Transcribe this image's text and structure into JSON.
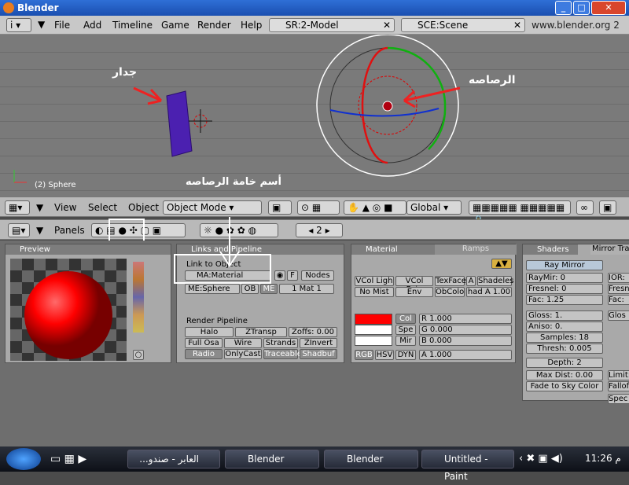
{
  "window": {
    "title": "Blender"
  },
  "menubar": {
    "items": [
      "File",
      "Add",
      "Timeline",
      "Game",
      "Render",
      "Help"
    ],
    "screen": "SR:2-Model",
    "scene": "SCE:Scene",
    "url": "www.blender.org 2"
  },
  "viewport": {
    "object_label": "(2) Sphere",
    "annotations": {
      "wall": "جدار",
      "bullet": "الرصاصه",
      "material_name": "أسم خامة الرصاصه"
    },
    "colors": {
      "wall": "#4b20b0",
      "ring_red": "#e01010",
      "ring_green": "#10b010",
      "ring_blue": "#1030d0"
    }
  },
  "view_header": {
    "view": "View",
    "select": "Select",
    "object": "Object",
    "mode": "Object Mode",
    "orientation": "Global"
  },
  "buttons_header": {
    "panels": "Panels",
    "frame": "2"
  },
  "preview": {
    "title": "Preview"
  },
  "links": {
    "title": "Links and Pipeline",
    "link_to_object": "Link to Object",
    "material": "MA:Material",
    "f": "F",
    "nodes": "Nodes",
    "mesh": "ME:Sphere",
    "ob": "OB",
    "me": "ME",
    "mat": "1 Mat 1",
    "render_pipeline": "Render Pipeline",
    "halo": "Halo",
    "ztransp": "ZTransp",
    "zoffs": "Zoffs: 0.00",
    "fullosa": "Full Osa",
    "wire": "Wire",
    "strands": "Strands",
    "zinvert": "ZInvert",
    "radio": "Radio",
    "onlycast": "OnlyCast",
    "traceable": "Traceable",
    "shadbuf": "Shadbuf"
  },
  "material": {
    "tab": "Material",
    "ramps": "Ramps",
    "vcol_light": "VCol Ligh",
    "vcol_paint": "VCol Pain",
    "texface": "TexFace",
    "a": "A",
    "shadeles": "Shadeles",
    "no_mist": "No Mist",
    "env": "Env",
    "obcolor": "ObColo",
    "hada": "had A 1.00",
    "col": "Col",
    "spe": "Spe",
    "mir": "Mir",
    "r": "R 1.000",
    "g": "G 0.000",
    "b": "B 0.000",
    "rgb": "RGB",
    "hsv": "HSV",
    "dyn": "DYN",
    "alpha": "A 1.000",
    "color": "#ff0000"
  },
  "shaders": {
    "tab": "Shaders",
    "mirror": "Mirror Tra",
    "ray_mirror": "Ray Mirror",
    "raymir": "RayMir: 0",
    "fresnel": "Fresnel: 0",
    "fac": "Fac: 1.25",
    "gloss": "Gloss: 1.",
    "aniso": "Aniso: 0.",
    "samples": "Samples: 18",
    "thresh": "Thresh: 0.005",
    "depth": "Depth: 2",
    "maxdist": "Max Dist: 0.00",
    "fade": "Fade to Sky Color",
    "ior": "IOR:",
    "fresn": "Fresn",
    "fac2": "Fac:",
    "gloss2": "Glos",
    "limit": "Limit:",
    "falloff": "Fallof",
    "spec": "Spec"
  },
  "taskbar": {
    "tasks": [
      "العابر - صندو...",
      "Blender",
      "Blender",
      "Untitled - Paint"
    ],
    "clock": "11:26 م"
  }
}
